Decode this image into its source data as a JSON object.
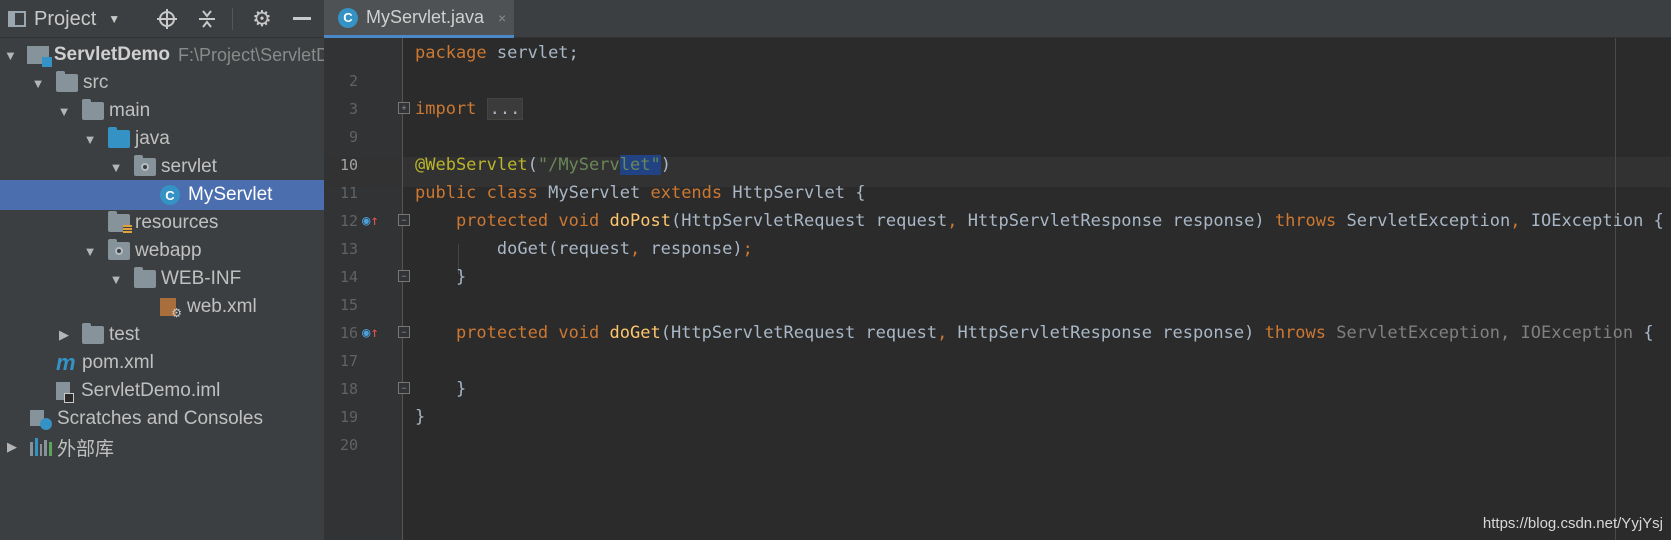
{
  "project_header": {
    "title": "Project",
    "icons": [
      "locate-icon",
      "collapse-icon",
      "settings-icon",
      "hide-icon"
    ]
  },
  "tree": {
    "root": {
      "label": "ServletDemo",
      "path": "F:\\Project\\ServletDemo"
    },
    "src": "src",
    "main": "main",
    "java": "java",
    "servlet": "servlet",
    "myservlet": "MyServlet",
    "resources": "resources",
    "webapp": "webapp",
    "webinf": "WEB-INF",
    "webxml": "web.xml",
    "test": "test",
    "pom": "pom.xml",
    "iml": "ServletDemo.iml",
    "scratches": "Scratches and Consoles",
    "libraries": "外部库"
  },
  "editor": {
    "tab_label": "MyServlet.java",
    "tab_close": "×",
    "class_glyph": "C",
    "line_numbers": [
      "2",
      "3",
      "9",
      "10",
      "11",
      "12",
      "13",
      "14",
      "15",
      "16",
      "17",
      "18",
      "19",
      "20"
    ],
    "current_line": "10",
    "code": {
      "l1_kw": "package",
      "l1_rest": " servlet;",
      "l3_kw": "import",
      "l3_fold": "...",
      "l10_ann": "@WebServlet",
      "l10_p1": "(",
      "l10_str_a": "\"/MyServ",
      "l10_str_sel": "let\"",
      "l10_p2": ")",
      "l11_kw1": "public",
      "l11_kw2": "class",
      "l11_name": "MyServlet",
      "l11_kw3": "extends",
      "l11_rest": "HttpServlet {",
      "l12_kw1": "protected",
      "l12_kw2": "void",
      "l12_fn": "doPost",
      "l12_params": "(HttpServletRequest request",
      "l12_comma": ",",
      "l12_params2": " HttpServletResponse response) ",
      "l12_throws": "throws",
      "l12_ex1": " ServletException",
      "l12_comma2": ",",
      "l12_ex2": " IOException {",
      "l13_call": "doGet(request",
      "l13_comma": ",",
      "l13_rest": " response)",
      "l13_semi": ";",
      "l14": "}",
      "l16_kw1": "protected",
      "l16_kw2": "void",
      "l16_fn": "doGet",
      "l16_params": "(HttpServletRequest request",
      "l16_comma": ",",
      "l16_params2": " HttpServletResponse response) ",
      "l16_throws": "throws",
      "l16_ex1": " ServletException",
      "l16_comma2": ",",
      "l16_ex2": " IOException",
      "l16_brace": " {",
      "l18": "}",
      "l19": "}"
    }
  },
  "watermark": "https://blog.csdn.net/YyjYsj"
}
